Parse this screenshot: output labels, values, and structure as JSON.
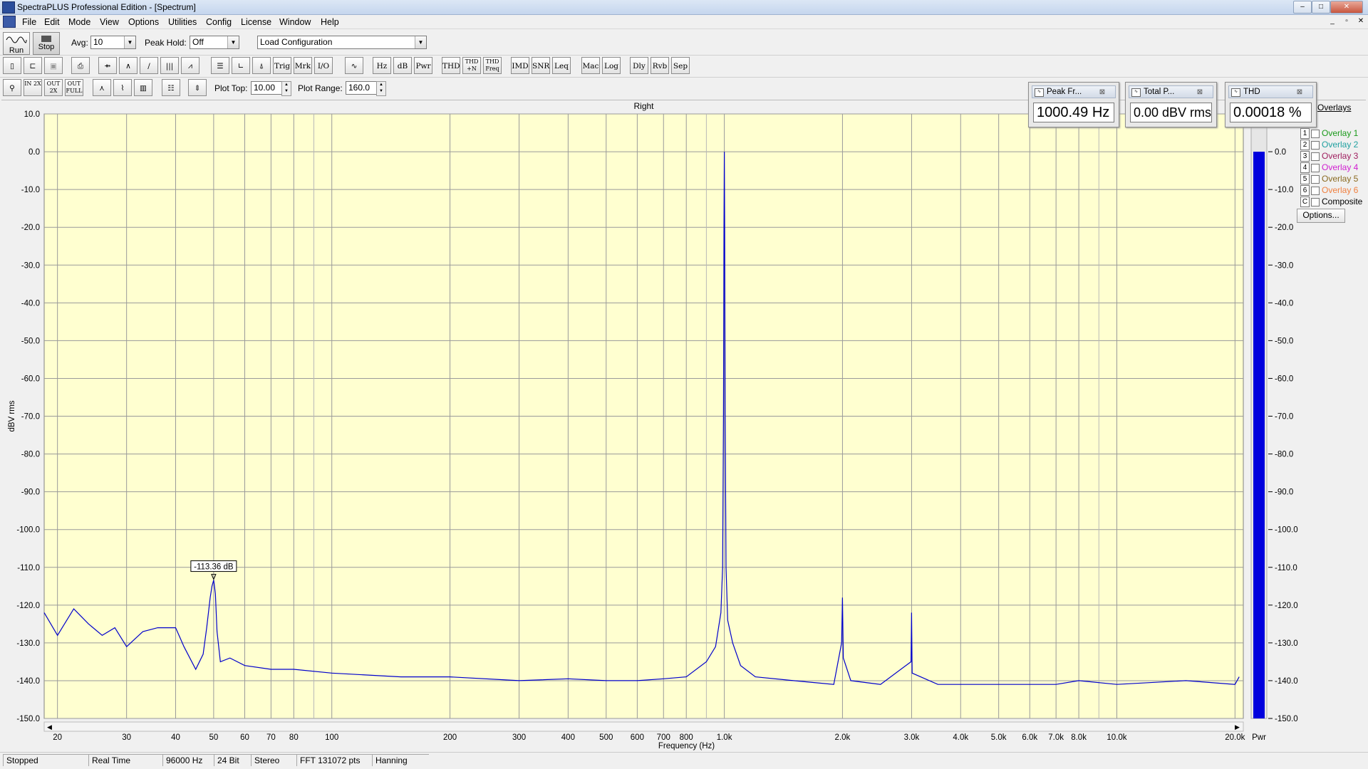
{
  "window": {
    "title": "SpectraPLUS Professional Edition - [Spectrum]",
    "controls": [
      "–",
      "□",
      "✕"
    ]
  },
  "menu": [
    "File",
    "Edit",
    "Mode",
    "View",
    "Options",
    "Utilities",
    "Config",
    "License",
    "Window",
    "Help"
  ],
  "mdi_controls": [
    "_",
    "▫",
    "✕"
  ],
  "toolbar1": {
    "run_label": "Run",
    "stop_label": "Stop",
    "avg_label": "Avg:",
    "avg_value": "10",
    "peakhold_label": "Peak Hold:",
    "peakhold_value": "Off",
    "config_value": "Load Configuration"
  },
  "toolbar2": {
    "buttons": [
      "Trig",
      "Mrk",
      "I/O",
      "Hz",
      "dB",
      "Pwr",
      "THD",
      "THD +N",
      "THD Freq",
      "IMD",
      "SNR",
      "Leq",
      "Mac",
      "Log",
      "Dly",
      "Rvb",
      "Sep"
    ]
  },
  "toolbar3": {
    "zoom_buttons": [
      "IN 2X",
      "OUT 2X",
      "OUT FULL"
    ],
    "plot_top_label": "Plot Top:",
    "plot_top_value": "10.00",
    "plot_range_label": "Plot Range:",
    "plot_range_value": "160.0"
  },
  "meters": [
    {
      "title": "Peak Fr...",
      "value": "1000.49 Hz"
    },
    {
      "title": "Total P...",
      "value": "0.00 dBV rms"
    },
    {
      "title": "THD",
      "value": "0.00018 %"
    }
  ],
  "overlays": {
    "header": "Overlays",
    "items": [
      {
        "num": "1",
        "label": "Overlay 1",
        "color": "#1a9a1a"
      },
      {
        "num": "2",
        "label": "Overlay 2",
        "color": "#20a0a0"
      },
      {
        "num": "3",
        "label": "Overlay 3",
        "color": "#a02060"
      },
      {
        "num": "4",
        "label": "Overlay 4",
        "color": "#d020d0"
      },
      {
        "num": "5",
        "label": "Overlay 5",
        "color": "#8a6a20"
      },
      {
        "num": "6",
        "label": "Overlay 6",
        "color": "#f08040"
      },
      {
        "num": "C",
        "label": "Composite",
        "color": "#000000"
      }
    ],
    "options_label": "Options..."
  },
  "pwr_meter": {
    "label": "Pwr",
    "level_dB": 0.0
  },
  "statusbar": [
    "Stopped",
    "Real Time",
    "96000 Hz",
    "24 Bit",
    "Stereo",
    "FFT 131072 pts",
    "Hanning"
  ],
  "chart_data": {
    "type": "line",
    "title": "Right",
    "xlabel": "Frequency (Hz)",
    "ylabel": "dBV rms",
    "xscale": "log",
    "xlim": [
      18.5,
      21000
    ],
    "ylim": [
      -150,
      10
    ],
    "grid": true,
    "background": "#ffffd0",
    "line_color": "#0000cc",
    "x_ticks": [
      "20",
      "30",
      "40",
      "50",
      "60",
      "70",
      "80",
      "100",
      "200",
      "300",
      "400",
      "500",
      "600",
      "700",
      "800",
      "1.0k",
      "2.0k",
      "3.0k",
      "4.0k",
      "5.0k",
      "6.0k",
      "7.0k",
      "8.0k",
      "10.0k",
      "20.0k"
    ],
    "y_ticks": [
      "10.0",
      "0.0",
      "-10.0",
      "-20.0",
      "-30.0",
      "-40.0",
      "-50.0",
      "-60.0",
      "-70.0",
      "-80.0",
      "-90.0",
      "-100.0",
      "-110.0",
      "-120.0",
      "-130.0",
      "-140.0",
      "-150.0"
    ],
    "marker": {
      "x": 50,
      "y": -113.36,
      "label": "-113.36 dB"
    },
    "series": [
      {
        "x": [
          18.5,
          20,
          22,
          24,
          26,
          28,
          30,
          33,
          36,
          40,
          42,
          45,
          47,
          48,
          49,
          49.5,
          50,
          50.5,
          51,
          52,
          55,
          60,
          70,
          80,
          100,
          150,
          200,
          300,
          400,
          500,
          600,
          700,
          800,
          900,
          950,
          980,
          990,
          995,
          998,
          1000,
          1002,
          1005,
          1010,
          1020,
          1050,
          1100,
          1200,
          1500,
          1900,
          1990,
          2000,
          2010,
          2100,
          2500,
          2990,
          3000,
          3010,
          3500,
          4000,
          5000,
          7000,
          8000,
          10000,
          15000,
          20000,
          20500
        ],
        "y": [
          -122,
          -128,
          -121,
          -125,
          -128,
          -126,
          -131,
          -127,
          -126,
          -126,
          -131,
          -137,
          -133,
          -126,
          -118,
          -115,
          -113.36,
          -117,
          -127,
          -135,
          -134,
          -136,
          -137,
          -137,
          -138,
          -139,
          -139,
          -140,
          -139.5,
          -140,
          -140,
          -139.5,
          -139,
          -135,
          -131,
          -122,
          -110,
          -70,
          -20,
          0,
          -20,
          -70,
          -110,
          -124,
          -130,
          -136,
          -139,
          -140,
          -141,
          -130,
          -118,
          -134,
          -140,
          -141,
          -135,
          -122,
          -138,
          -141,
          -141,
          -141,
          -141,
          -140,
          -141,
          -140,
          -141,
          -139
        ]
      }
    ]
  }
}
